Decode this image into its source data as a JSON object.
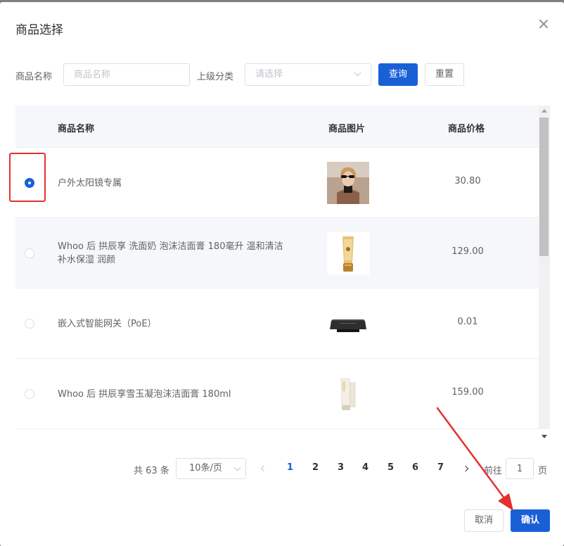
{
  "dialog": {
    "title": "商品选择"
  },
  "filters": {
    "name_label": "商品名称",
    "name_placeholder": "商品名称",
    "category_label": "上级分类",
    "category_placeholder": "请选择",
    "query_button": "查询",
    "reset_button": "重置"
  },
  "table": {
    "columns": [
      "商品名称",
      "商品图片",
      "商品价格"
    ],
    "rows": [
      {
        "name": "户外太阳镜专属",
        "price": "30.80",
        "selected": true,
        "image": "sunglasses-woman-photo"
      },
      {
        "name": "Whoo 后 拱辰享 洗面奶 泡沫洁面膏 180毫升 温和清洁 补水保湿 润颜",
        "price": "129.00",
        "selected": false,
        "image": "gold-cleanser-tube-photo"
      },
      {
        "name": "嵌入式智能网关（PoE）",
        "price": "0.01",
        "selected": false,
        "image": "black-gateway-device-photo"
      },
      {
        "name": "Whoo 后 拱辰享雪玉凝泡沫洁面膏 180ml",
        "price": "159.00",
        "selected": false,
        "image": "white-cleanser-tube-photo"
      }
    ]
  },
  "pagination": {
    "total": "共 63 条",
    "page_size": "10条/页",
    "pages": [
      "1",
      "2",
      "3",
      "4",
      "5",
      "6",
      "7"
    ],
    "current": "1",
    "goto_label": "前往",
    "goto_value": "1",
    "page_suffix": "页"
  },
  "footer": {
    "cancel_button": "取消",
    "confirm_button": "确认"
  },
  "colors": {
    "primary": "#1960d7",
    "highlight": "#e5302e"
  }
}
